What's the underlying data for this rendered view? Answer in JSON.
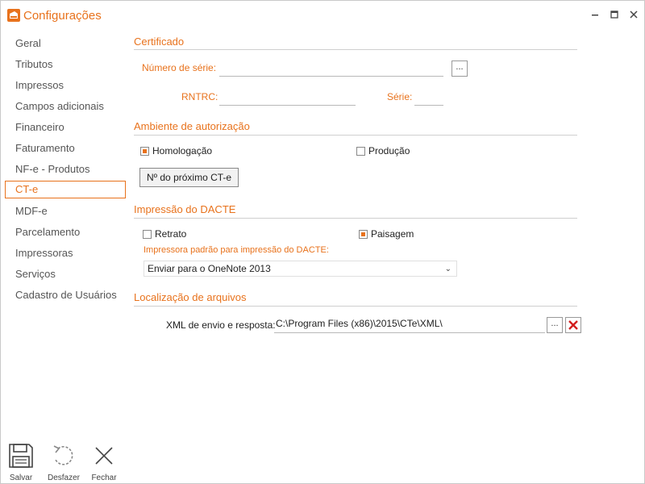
{
  "window": {
    "title": "Configurações",
    "accent": "#e8721c"
  },
  "sidebar": {
    "active_index": 7,
    "items": [
      {
        "label": "Geral"
      },
      {
        "label": "Tributos"
      },
      {
        "label": "Impressos"
      },
      {
        "label": "Campos adicionais"
      },
      {
        "label": "Financeiro"
      },
      {
        "label": "Faturamento"
      },
      {
        "label": "NF-e - Produtos"
      },
      {
        "label": "CT-e"
      },
      {
        "label": "MDF-e"
      },
      {
        "label": "Parcelamento"
      },
      {
        "label": "Impressoras"
      },
      {
        "label": "Serviços"
      },
      {
        "label": "Cadastro de Usuários"
      }
    ]
  },
  "certificado": {
    "title": "Certificado",
    "serial_label": "Número de série:",
    "serial_value": "",
    "browse_label": "...",
    "rntrc_label": "RNTRC:",
    "rntrc_value": "",
    "serie_label": "Série:",
    "serie_value": ""
  },
  "ambiente": {
    "title": "Ambiente de autorização",
    "options": [
      {
        "label": "Homologação",
        "checked": true
      },
      {
        "label": "Produção",
        "checked": false
      }
    ],
    "next_button": "Nº do próximo CT-e"
  },
  "impressao": {
    "title": "Impressão do DACTE",
    "options": [
      {
        "label": "Retrato",
        "checked": false
      },
      {
        "label": "Paisagem",
        "checked": true
      }
    ],
    "printer_label": "Impressora padrão para impressão do DACTE:",
    "printer_value": "Enviar para o OneNote 2013"
  },
  "arquivos": {
    "title": "Localização de arquivos",
    "xml_label": "XML de envio e resposta:",
    "xml_value": "C:\\Program Files (x86)\\2015\\CTe\\XML\\",
    "browse_label": "..."
  },
  "toolbar": {
    "save_label": "Salvar",
    "undo_label": "Desfazer",
    "close_label": "Fechar"
  }
}
